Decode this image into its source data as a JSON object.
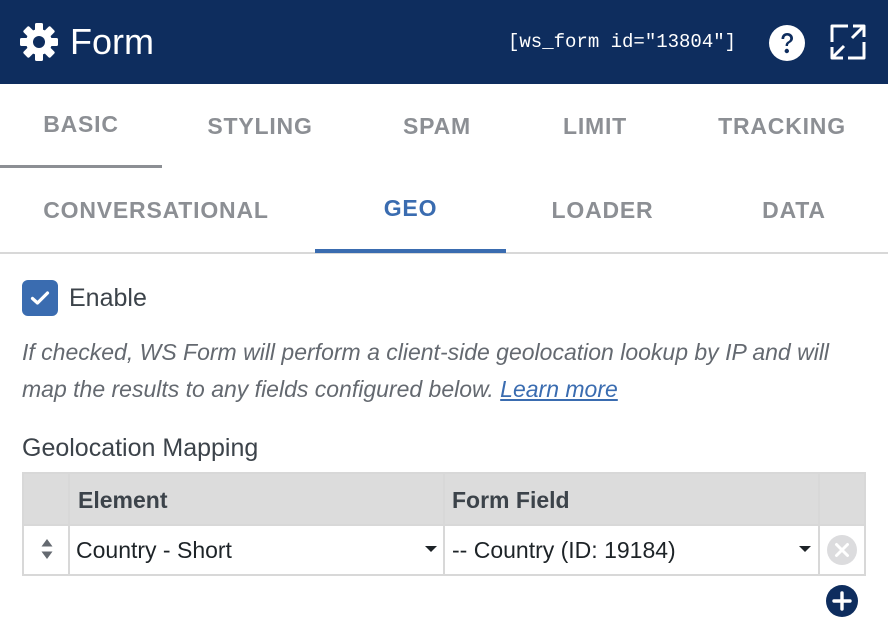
{
  "header": {
    "title": "Form",
    "shortcode": "[ws_form id=\"13804\"]",
    "background": "#0e2d5e"
  },
  "tabs_row1": [
    {
      "label": "BASIC",
      "active": true
    },
    {
      "label": "STYLING",
      "active": false
    },
    {
      "label": "SPAM",
      "active": false
    },
    {
      "label": "LIMIT",
      "active": false
    },
    {
      "label": "TRACKING",
      "active": false
    }
  ],
  "tabs_row2": [
    {
      "label": "CONVERSATIONAL",
      "active": false
    },
    {
      "label": "GEO",
      "active": true
    },
    {
      "label": "LOADER",
      "active": false
    },
    {
      "label": "DATA",
      "active": false
    }
  ],
  "enable": {
    "label": "Enable",
    "checked": true
  },
  "help": {
    "text": "If checked, WS Form will perform a client-side geolocation lookup by IP and will map the results to any fields configured below. ",
    "link": "Learn more"
  },
  "mapping": {
    "label": "Geolocation Mapping",
    "columns": [
      "Element",
      "Form Field"
    ],
    "rows": [
      {
        "element": "Country - Short",
        "form_field": "-- Country (ID: 19184)"
      }
    ]
  },
  "colors": {
    "accent": "#3a6cb0",
    "muted_tab": "#8c8f94"
  }
}
